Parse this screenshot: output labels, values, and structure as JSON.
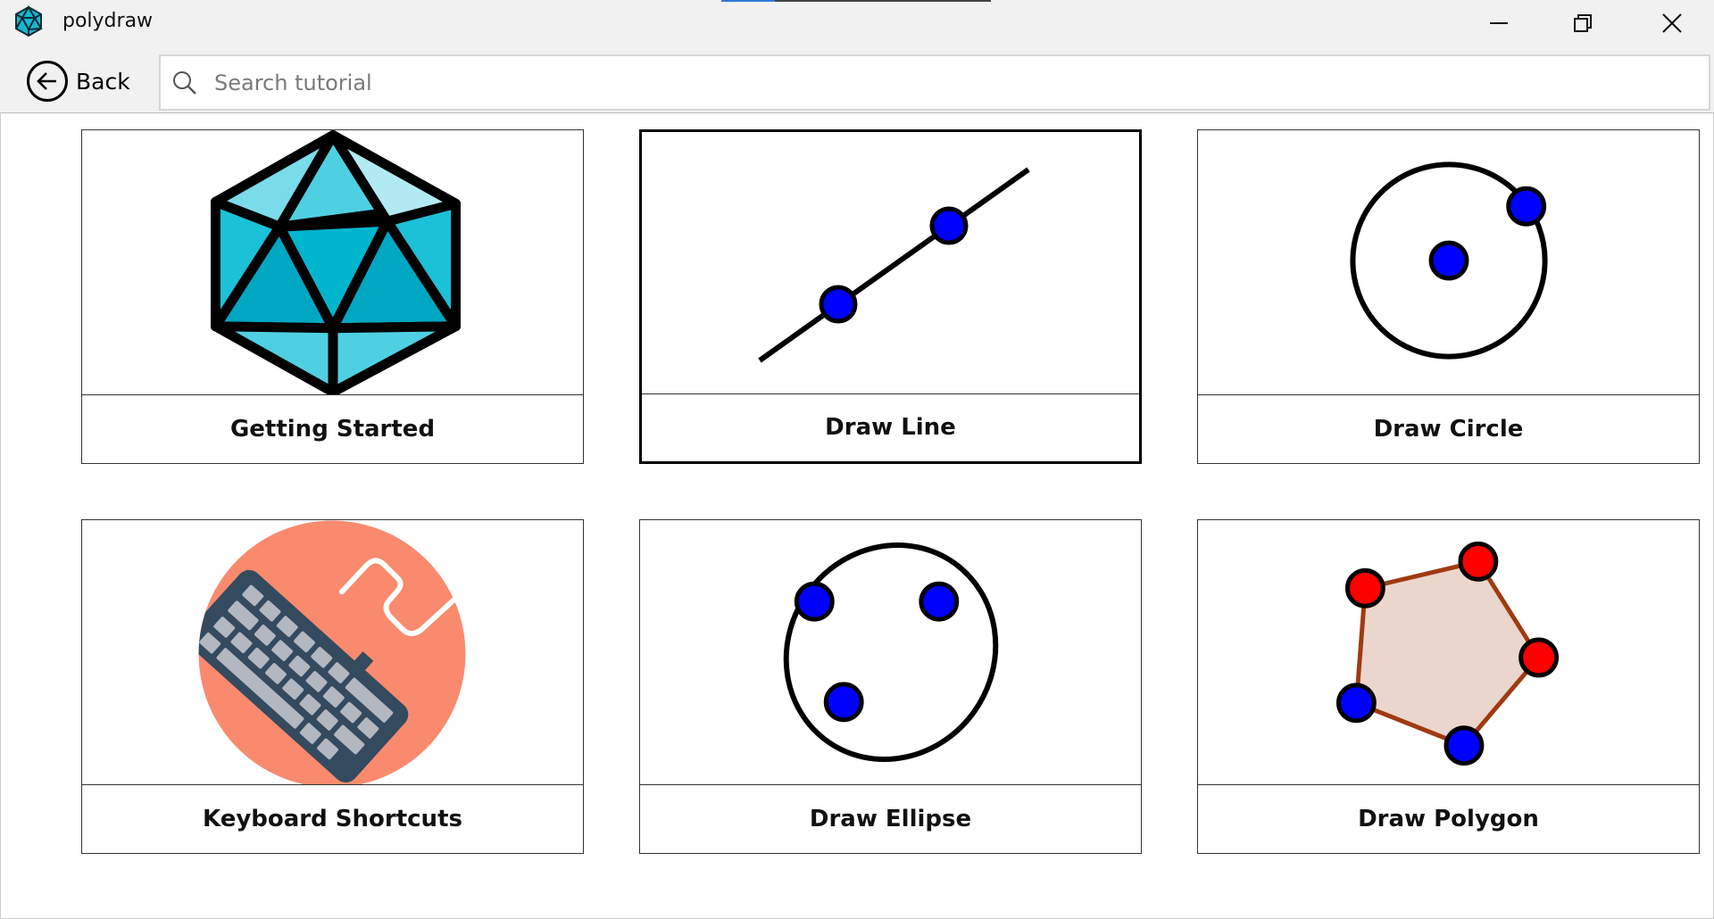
{
  "window": {
    "title": "polydraw",
    "controls": {
      "minimize": "minimize-icon",
      "maximize": "restore-icon",
      "close": "close-icon"
    }
  },
  "toolbar": {
    "back_label": "Back",
    "search_placeholder": "Search tutorial",
    "search_value": ""
  },
  "tutorials": [
    {
      "label": "Getting Started",
      "icon": "icosahedron-icon"
    },
    {
      "label": "Draw Line",
      "icon": "line-icon",
      "selected": true
    },
    {
      "label": "Draw Circle",
      "icon": "circle-icon"
    },
    {
      "label": "Keyboard Shortcuts",
      "icon": "keyboard-icon"
    },
    {
      "label": "Draw Ellipse",
      "icon": "ellipse-icon"
    },
    {
      "label": "Draw Polygon",
      "icon": "polygon-icon"
    }
  ],
  "colors": {
    "point_blue": "#0000ff",
    "point_red": "#ff0000",
    "polygon_edge": "#a03a10",
    "polygon_fill": "#ead6cc",
    "keyboard_bg": "#fa8a6e",
    "keyboard_body": "#344a5e",
    "keyboard_keys": "#b2b7c0",
    "icosa_light": "#b2eaf3",
    "icosa_mid": "#4fd0e2",
    "icosa_dark": "#00b5ce"
  }
}
